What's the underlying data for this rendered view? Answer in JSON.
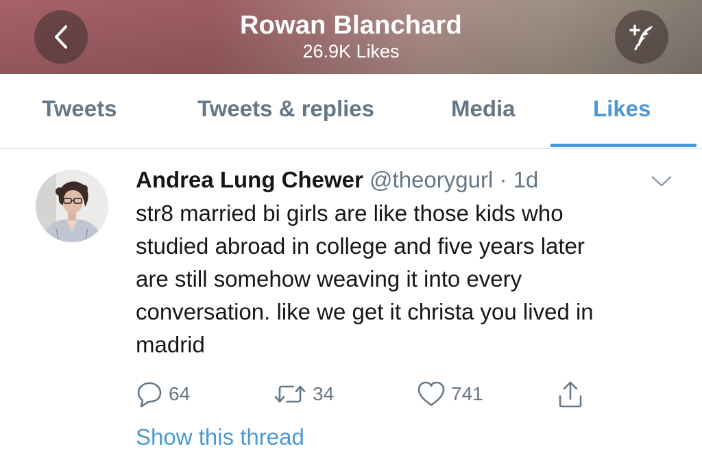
{
  "header": {
    "title": "Rowan Blanchard",
    "subtitle": "26.9K Likes",
    "back_icon": "chevron-left-icon",
    "compose_icon": "compose-tweet-icon"
  },
  "tabs": [
    {
      "label": "Tweets",
      "active": false
    },
    {
      "label": "Tweets & replies",
      "active": false
    },
    {
      "label": "Media",
      "active": false
    },
    {
      "label": "Likes",
      "active": true
    }
  ],
  "tweet": {
    "author_name": "Andrea Lung Chewer",
    "author_handle": "@theorygurl",
    "time": " · 1d",
    "text": "str8 married bi girls are like those kids who\nstudied abroad in college and five years later\nare still somehow weaving it into every\nconversation. like we get it christa you lived in\nmadrid",
    "replies": "64",
    "retweets": "34",
    "likes": "741",
    "show_thread": "Show this thread"
  },
  "colors": {
    "accent": "#4a99d6",
    "muted": "#657786",
    "text": "#14171a"
  }
}
